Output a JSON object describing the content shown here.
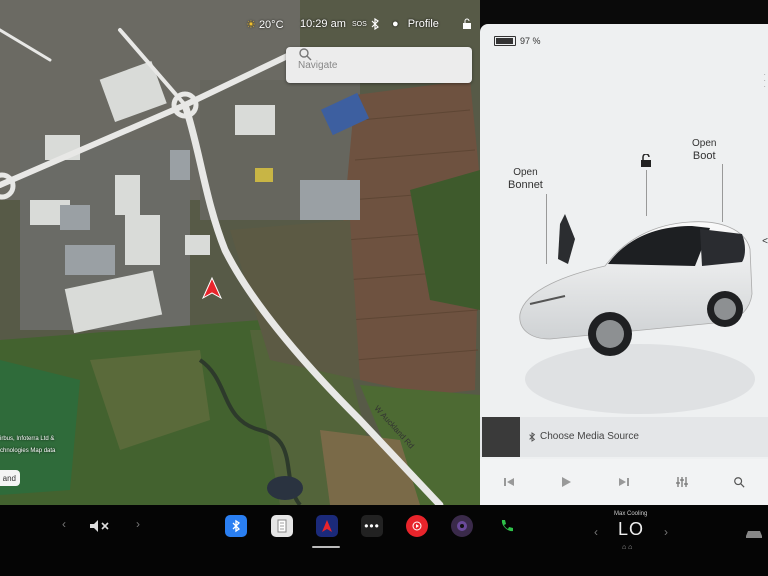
{
  "status": {
    "temperature": "20°C",
    "time": "10:29 am",
    "sos": "SOS",
    "profile_label": "Profile"
  },
  "navigate": {
    "placeholder": "Navigate"
  },
  "map": {
    "road_label": "W Auckland Rd",
    "credit_line1": "irbus, Infoterra Ltd &",
    "credit_line2": "chnologies Map data",
    "scale_label": "and"
  },
  "car": {
    "battery_percent": 97,
    "battery_label": "97 %",
    "bonnet_label_1": "Open",
    "bonnet_label_2": "Bonnet",
    "boot_label_1": "Open",
    "boot_label_2": "Boot"
  },
  "media": {
    "source_label": "Choose Media Source"
  },
  "climate": {
    "mode_label": "Max Cooling",
    "temperature": "LO"
  },
  "colors": {
    "accent_red": "#e8242b",
    "bluetooth_blue": "#2a7ff2",
    "phone_green": "#2fc24a",
    "panel_bg": "#eef0f1"
  },
  "icons": [
    "sun-icon",
    "bluetooth-icon",
    "person-icon",
    "lock-icon",
    "search-icon",
    "mute-icon",
    "notepad-icon",
    "nav-app-icon",
    "more-icon",
    "music-icon",
    "camera-icon",
    "phone-icon",
    "seat-heat-icon",
    "car-icon"
  ]
}
